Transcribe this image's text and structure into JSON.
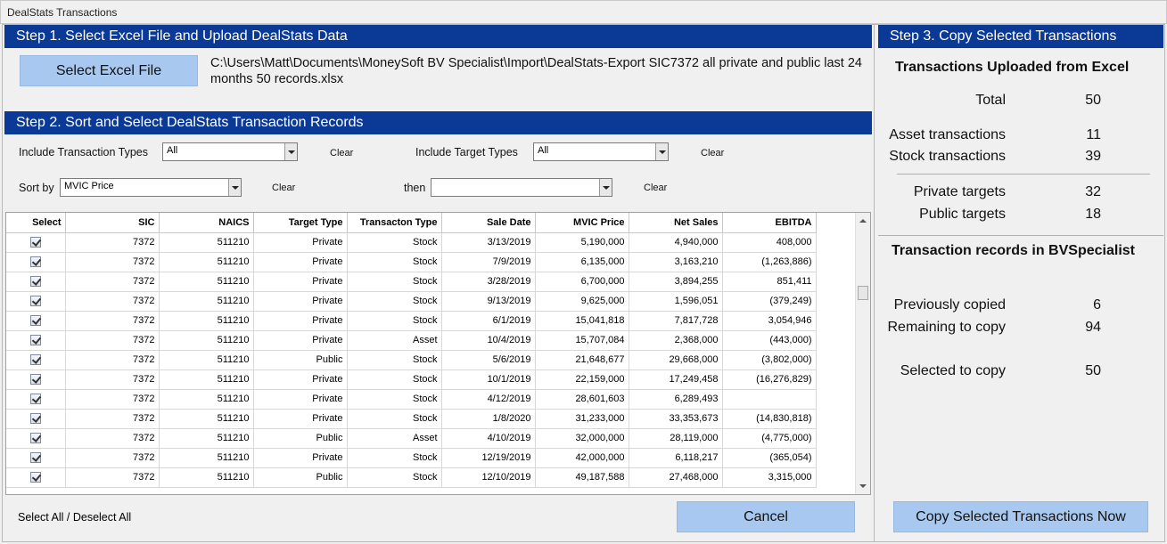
{
  "window": {
    "title": "DealStats Transactions"
  },
  "step1": {
    "header": "Step 1. Select Excel File and Upload DealStats Data",
    "select_button": "Select Excel File",
    "file_path": "C:\\Users\\Matt\\Documents\\MoneySoft BV Specialist\\Import\\DealStats-Export SIC7372 all private and public last 24 months 50 records.xlsx"
  },
  "step2": {
    "header": "Step 2. Sort and Select DealStats Transaction Records",
    "include_transaction_types_label": "Include Transaction Types",
    "transaction_types_value": "All",
    "include_target_types_label": "Include Target Types",
    "target_types_value": "All",
    "sort_by_label": "Sort by",
    "sort_by_value": "MVIC Price",
    "then_label": "then",
    "then_value": "",
    "clear_label": "Clear",
    "select_all_label": "Select All / Deselect All",
    "cancel_button": "Cancel"
  },
  "table": {
    "columns": [
      "Select",
      "SIC",
      "NAICS",
      "Target Type",
      "Transacton Type",
      "Sale Date",
      "MVIC Price",
      "Net Sales",
      "EBITDA"
    ],
    "rows": [
      [
        "7372",
        "511210",
        "Private",
        "Stock",
        "3/13/2019",
        "5,190,000",
        "4,940,000",
        "408,000"
      ],
      [
        "7372",
        "511210",
        "Private",
        "Stock",
        "7/9/2019",
        "6,135,000",
        "3,163,210",
        "(1,263,886)"
      ],
      [
        "7372",
        "511210",
        "Private",
        "Stock",
        "3/28/2019",
        "6,700,000",
        "3,894,255",
        "851,411"
      ],
      [
        "7372",
        "511210",
        "Private",
        "Stock",
        "9/13/2019",
        "9,625,000",
        "1,596,051",
        "(379,249)"
      ],
      [
        "7372",
        "511210",
        "Private",
        "Stock",
        "6/1/2019",
        "15,041,818",
        "7,817,728",
        "3,054,946"
      ],
      [
        "7372",
        "511210",
        "Private",
        "Asset",
        "10/4/2019",
        "15,707,084",
        "2,368,000",
        "(443,000)"
      ],
      [
        "7372",
        "511210",
        "Public",
        "Stock",
        "5/6/2019",
        "21,648,677",
        "29,668,000",
        "(3,802,000)"
      ],
      [
        "7372",
        "511210",
        "Private",
        "Stock",
        "10/1/2019",
        "22,159,000",
        "17,249,458",
        "(16,276,829)"
      ],
      [
        "7372",
        "511210",
        "Private",
        "Stock",
        "4/12/2019",
        "28,601,603",
        "6,289,493",
        ""
      ],
      [
        "7372",
        "511210",
        "Private",
        "Stock",
        "1/8/2020",
        "31,233,000",
        "33,353,673",
        "(14,830,818)"
      ],
      [
        "7372",
        "511210",
        "Public",
        "Asset",
        "4/10/2019",
        "32,000,000",
        "28,119,000",
        "(4,775,000)"
      ],
      [
        "7372",
        "511210",
        "Private",
        "Stock",
        "12/19/2019",
        "42,000,000",
        "6,118,217",
        "(365,054)"
      ],
      [
        "7372",
        "511210",
        "Public",
        "Stock",
        "12/10/2019",
        "49,187,588",
        "27,468,000",
        "3,315,000"
      ]
    ]
  },
  "step3": {
    "header": "Step 3. Copy Selected Transactions",
    "uploaded_title": "Transactions Uploaded from Excel",
    "total_label": "Total",
    "total_value": "50",
    "asset_label": "Asset transactions",
    "asset_value": "11",
    "stock_label": "Stock transactions",
    "stock_value": "39",
    "private_label": "Private targets",
    "private_value": "32",
    "public_label": "Public targets",
    "public_value": "18",
    "records_title": "Transaction records in BVSpecialist",
    "prev_label": "Previously copied",
    "prev_value": "6",
    "remaining_label": "Remaining to copy",
    "remaining_value": "94",
    "selected_label": "Selected to copy",
    "selected_value": "50",
    "copy_button": "Copy Selected Transactions Now"
  },
  "colors": {
    "header_bg": "#0b3a96",
    "button_bg": "#a8c8ef"
  }
}
